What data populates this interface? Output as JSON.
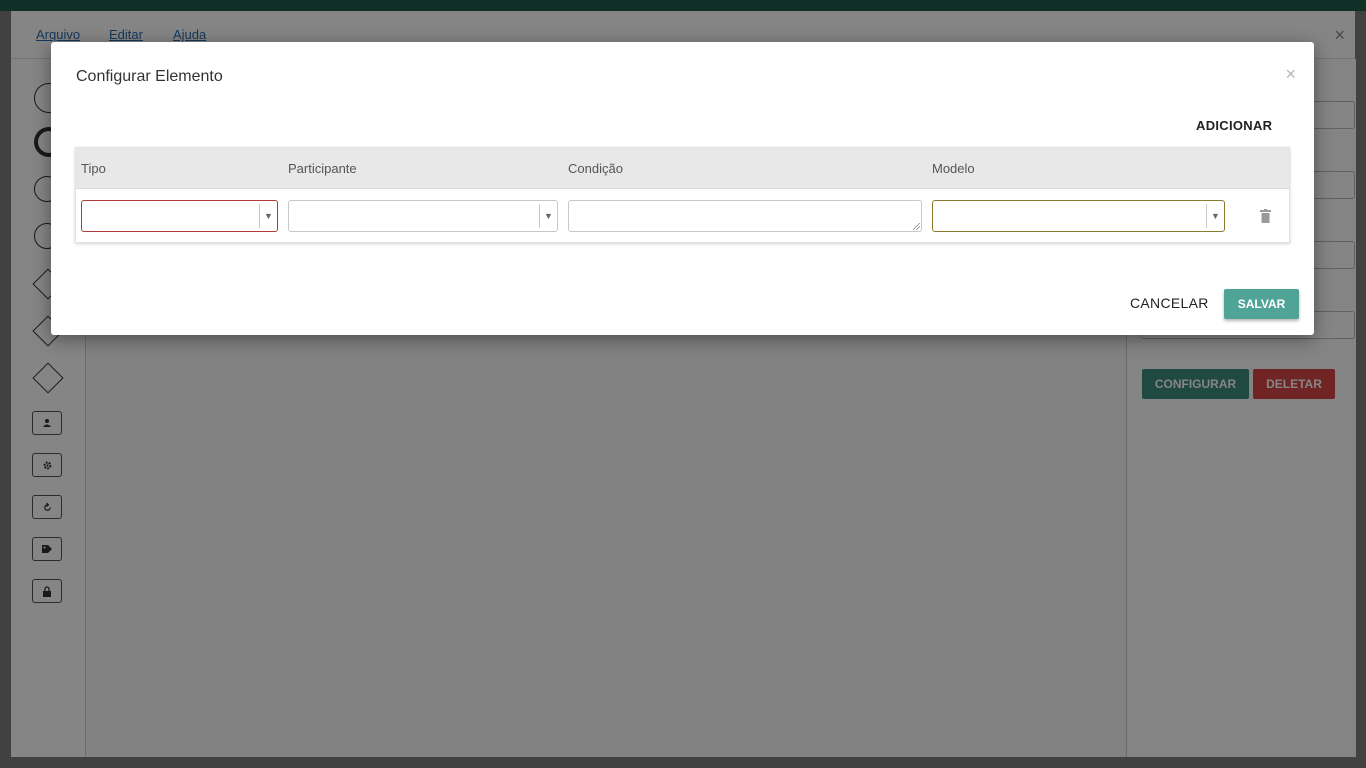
{
  "app": {
    "menu": [
      {
        "label": "Arquivo"
      },
      {
        "label": "Editar"
      },
      {
        "label": "Ajuda"
      }
    ],
    "close_glyph": "×",
    "side_panel": {
      "configure_label": "CONFIGURAR",
      "delete_label": "DELETAR"
    },
    "zoom": {
      "in_glyph": "+",
      "out_glyph": "−"
    }
  },
  "modal": {
    "title": "Configurar Elemento",
    "close_glyph": "×",
    "add_label": "ADICIONAR",
    "columns": [
      {
        "label": "Tipo"
      },
      {
        "label": "Participante"
      },
      {
        "label": "Condição"
      },
      {
        "label": "Modelo"
      }
    ],
    "row": {
      "tipo": "",
      "participante": "",
      "condicao": "",
      "modelo": ""
    },
    "cancel_label": "CANCELAR",
    "save_label": "SALVAR"
  },
  "colors": {
    "accent": "#4fa497",
    "configure": "#3d8c7e",
    "delete": "#d64545",
    "topbar": "#1e5b4c",
    "invalid_border": "#b03a3a",
    "modelo_border": "#8a7a2a"
  },
  "icons": [
    "trash-icon",
    "close-icon",
    "target-icon",
    "user-icon",
    "gear-icon",
    "rotate-icon",
    "tag-icon",
    "lock-icon"
  ]
}
